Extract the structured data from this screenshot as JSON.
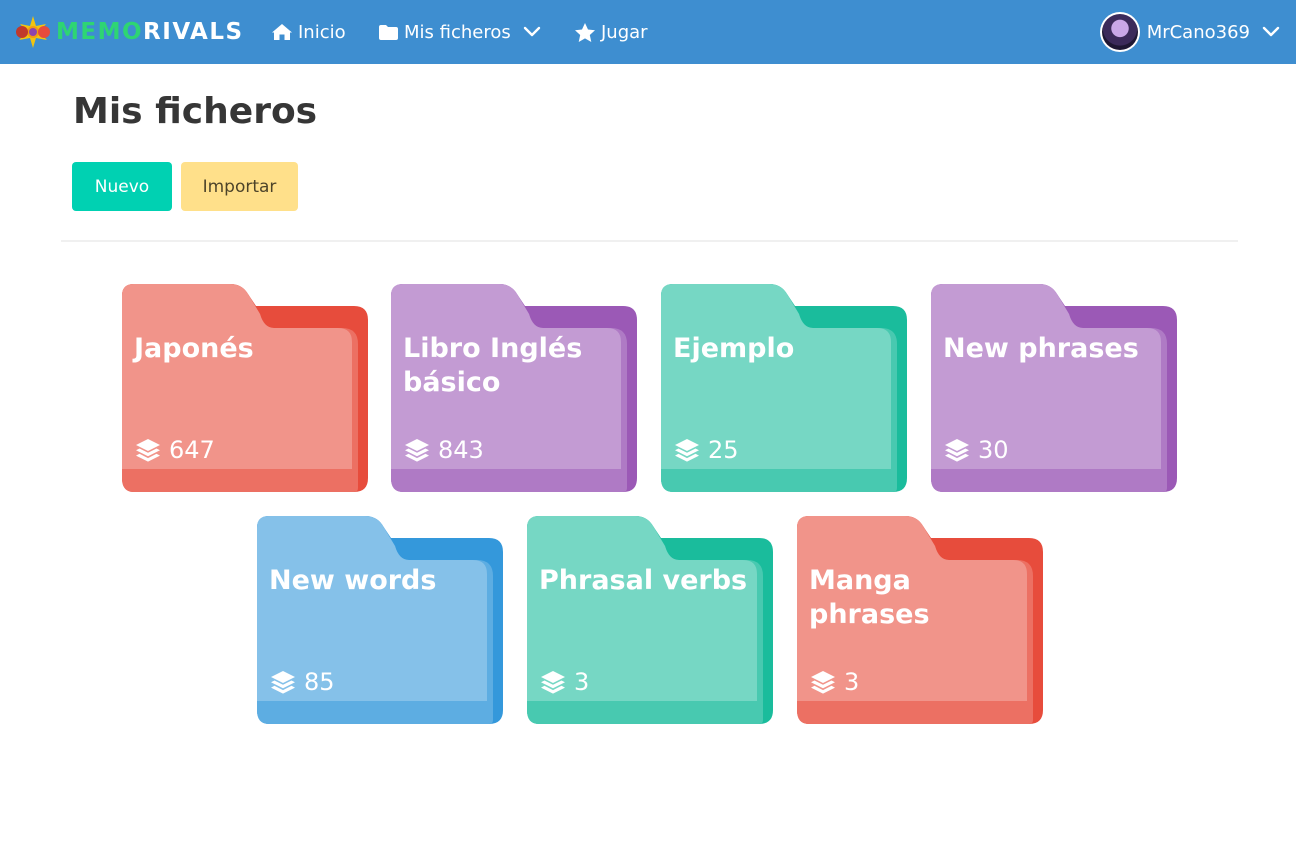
{
  "navbar": {
    "logo": {
      "part1": "MEMO",
      "part2": "RIVALS"
    },
    "items": [
      {
        "label": "Inicio",
        "icon": "home-icon"
      },
      {
        "label": "Mis ficheros",
        "icon": "folder-icon",
        "has_dropdown": true
      },
      {
        "label": "Jugar",
        "icon": "star-icon"
      }
    ],
    "user": {
      "name": "MrCano369",
      "icon": "avatar"
    }
  },
  "page": {
    "title": "Mis ficheros",
    "buttons": {
      "new_label": "Nuevo",
      "import_label": "Importar"
    }
  },
  "folders": [
    {
      "name": "Japonés",
      "count": "647",
      "color": "red"
    },
    {
      "name": "Libro Inglés básico",
      "count": "843",
      "color": "purple"
    },
    {
      "name": "Ejemplo",
      "count": "25",
      "color": "teal"
    },
    {
      "name": "New phrases",
      "count": "30",
      "color": "purple"
    },
    {
      "name": "New words",
      "count": "85",
      "color": "blue"
    },
    {
      "name": "Phrasal verbs",
      "count": "3",
      "color": "teal"
    },
    {
      "name": "Manga phrases",
      "count": "3",
      "color": "red"
    }
  ],
  "colors": {
    "navbar": "#3e8ed0",
    "primary_button": "#00d1b2",
    "warning_button": "#ffe08a",
    "red": {
      "front": "#f1948a",
      "back": "#e74c3c",
      "side": "#ec7063"
    },
    "purple": {
      "front": "#c39bd3",
      "back": "#9b59b6",
      "side": "#af7ac5"
    },
    "teal": {
      "front": "#76d7c4",
      "back": "#1abc9c",
      "side": "#48c9b0"
    },
    "blue": {
      "front": "#85c1e9",
      "back": "#3498db",
      "side": "#5dade2"
    }
  }
}
